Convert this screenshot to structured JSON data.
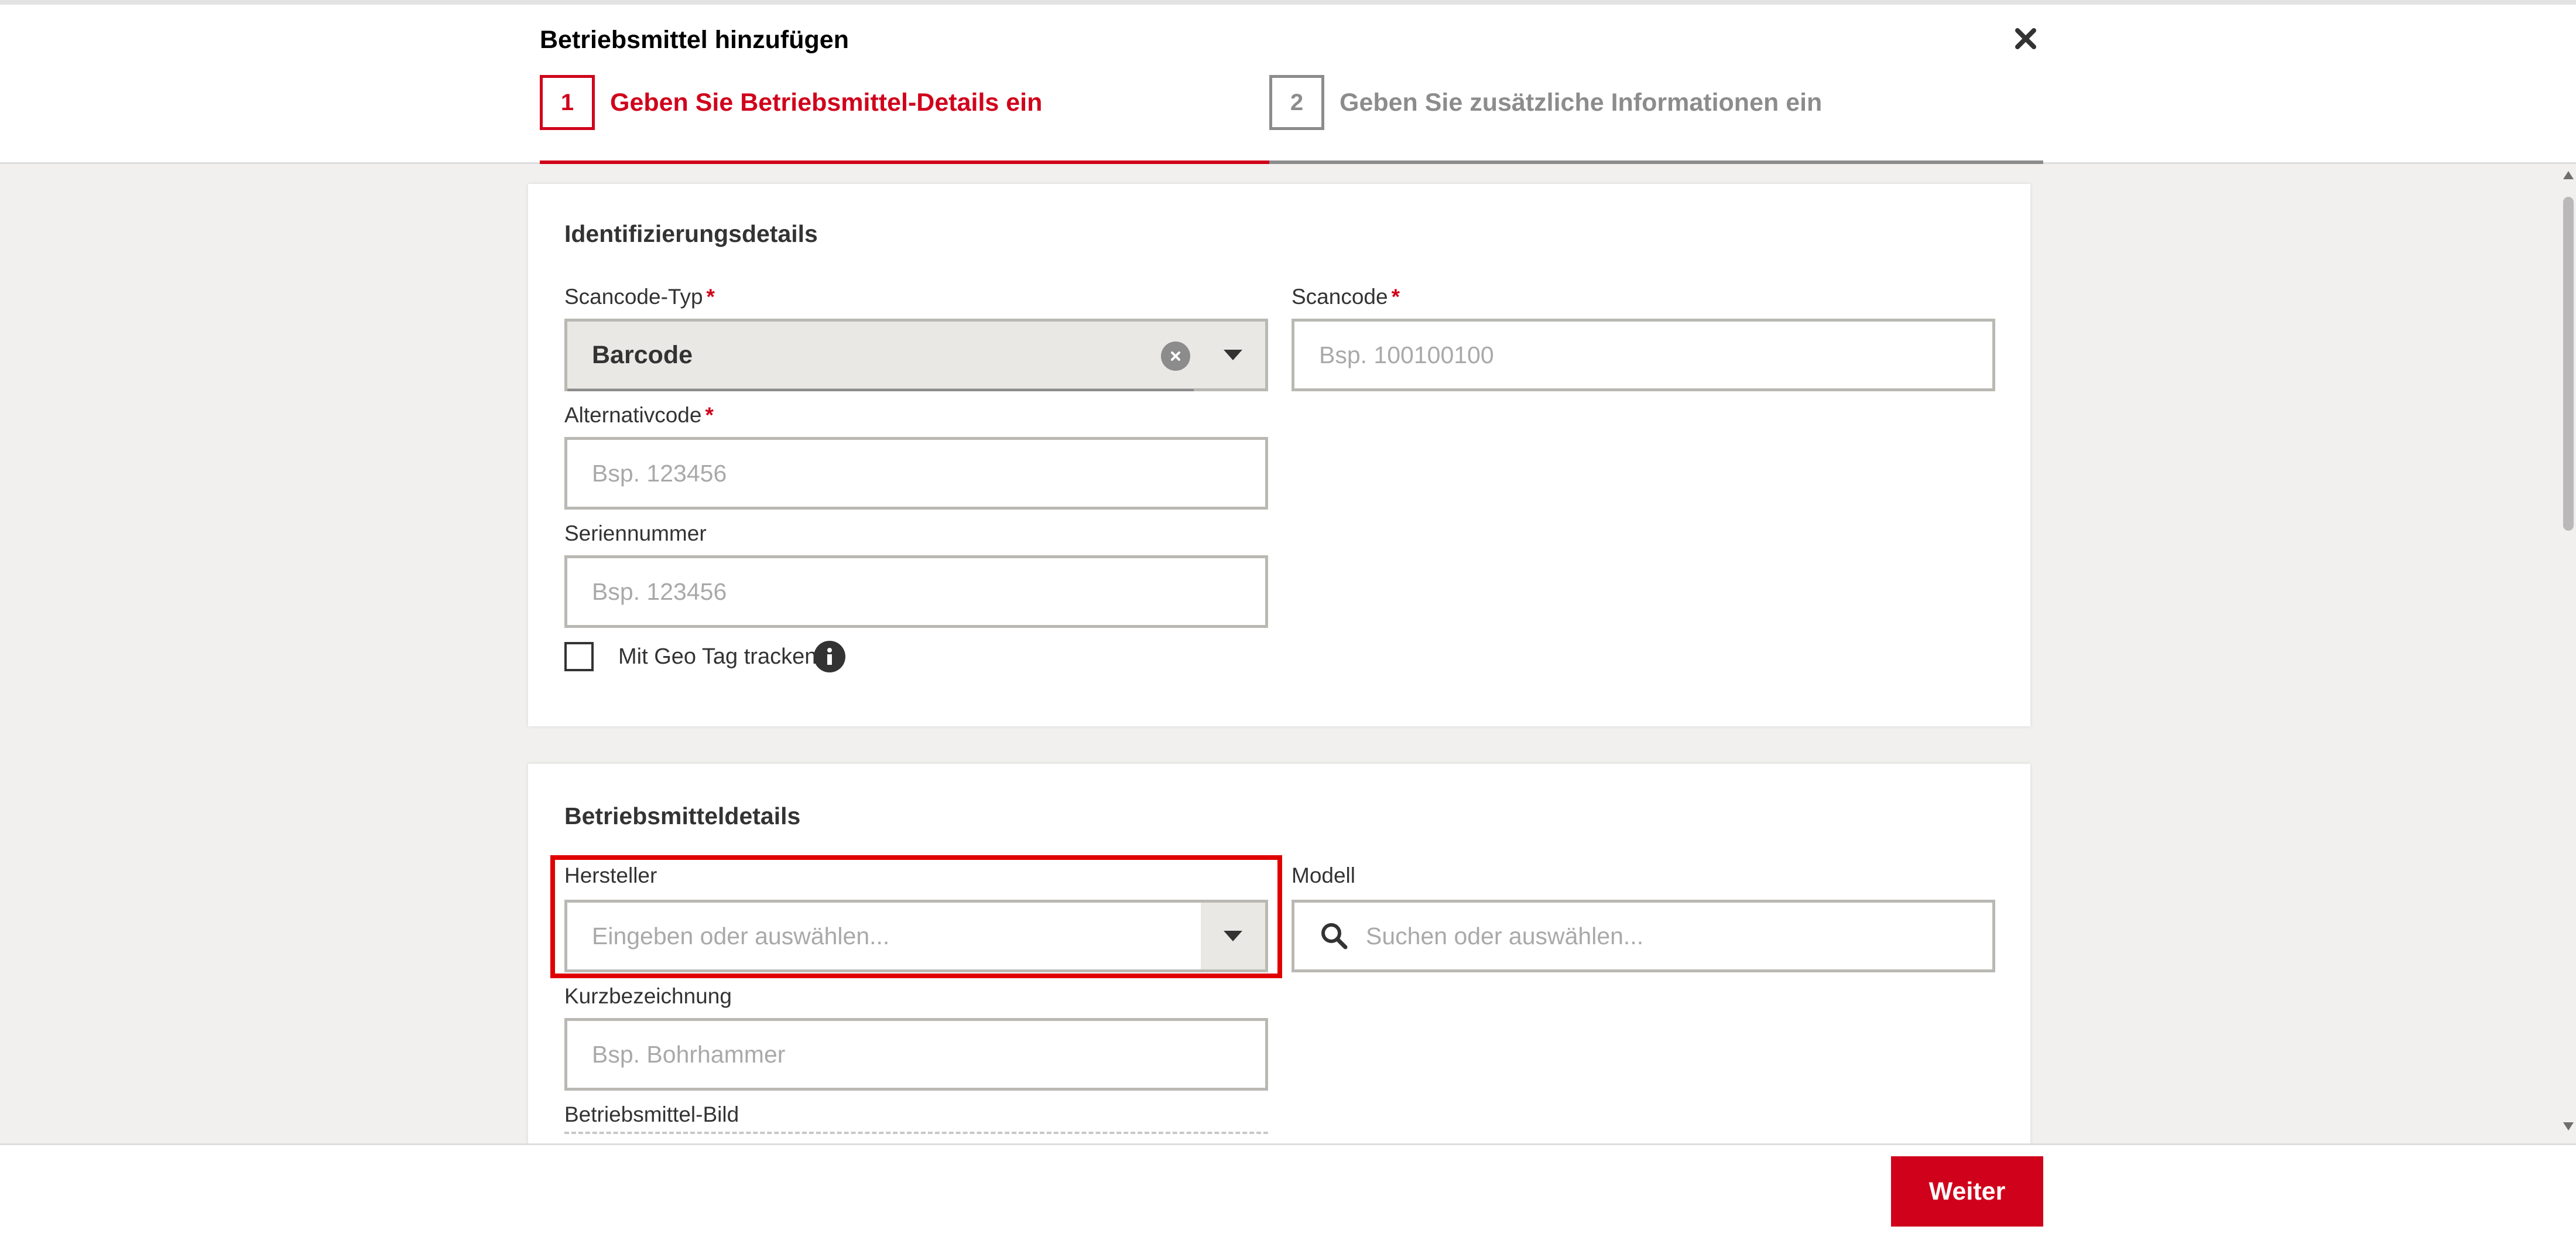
{
  "dialog": {
    "title": "Betriebsmittel hinzufügen",
    "close_icon": "close-icon"
  },
  "steps": [
    {
      "number": "1",
      "label": "Geben Sie Betriebsmittel-Details ein",
      "state": "active"
    },
    {
      "number": "2",
      "label": "Geben Sie zusätzliche Informationen ein",
      "state": "inactive"
    }
  ],
  "identification": {
    "title": "Identifizierungsdetails",
    "scancode_type": {
      "label": "Scancode-Typ",
      "required_mark": "*",
      "value": "Barcode"
    },
    "scancode": {
      "label": "Scancode",
      "required_mark": "*",
      "placeholder": "Bsp. 100100100"
    },
    "alternative_code": {
      "label": "Alternativcode",
      "required_mark": "*",
      "placeholder": "Bsp. 123456"
    },
    "serial_number": {
      "label": "Seriennummer",
      "placeholder": "Bsp. 123456"
    },
    "geo_tag": {
      "label": "Mit Geo Tag tracken",
      "checked": false
    }
  },
  "asset_details": {
    "title": "Betriebsmitteldetails",
    "manufacturer": {
      "label": "Hersteller",
      "placeholder": "Eingeben oder auswählen..."
    },
    "model": {
      "label": "Modell",
      "placeholder": "Suchen oder auswählen..."
    },
    "short_name": {
      "label": "Kurzbezeichnung",
      "placeholder": "Bsp. Bohrhammer"
    },
    "image": {
      "label": "Betriebsmittel-Bild"
    }
  },
  "footer": {
    "next_label": "Weiter"
  },
  "colors": {
    "accent": "#d0021b",
    "inactive": "#8c8c8c",
    "background": "#f1f0ee",
    "highlight": "#e00000"
  }
}
